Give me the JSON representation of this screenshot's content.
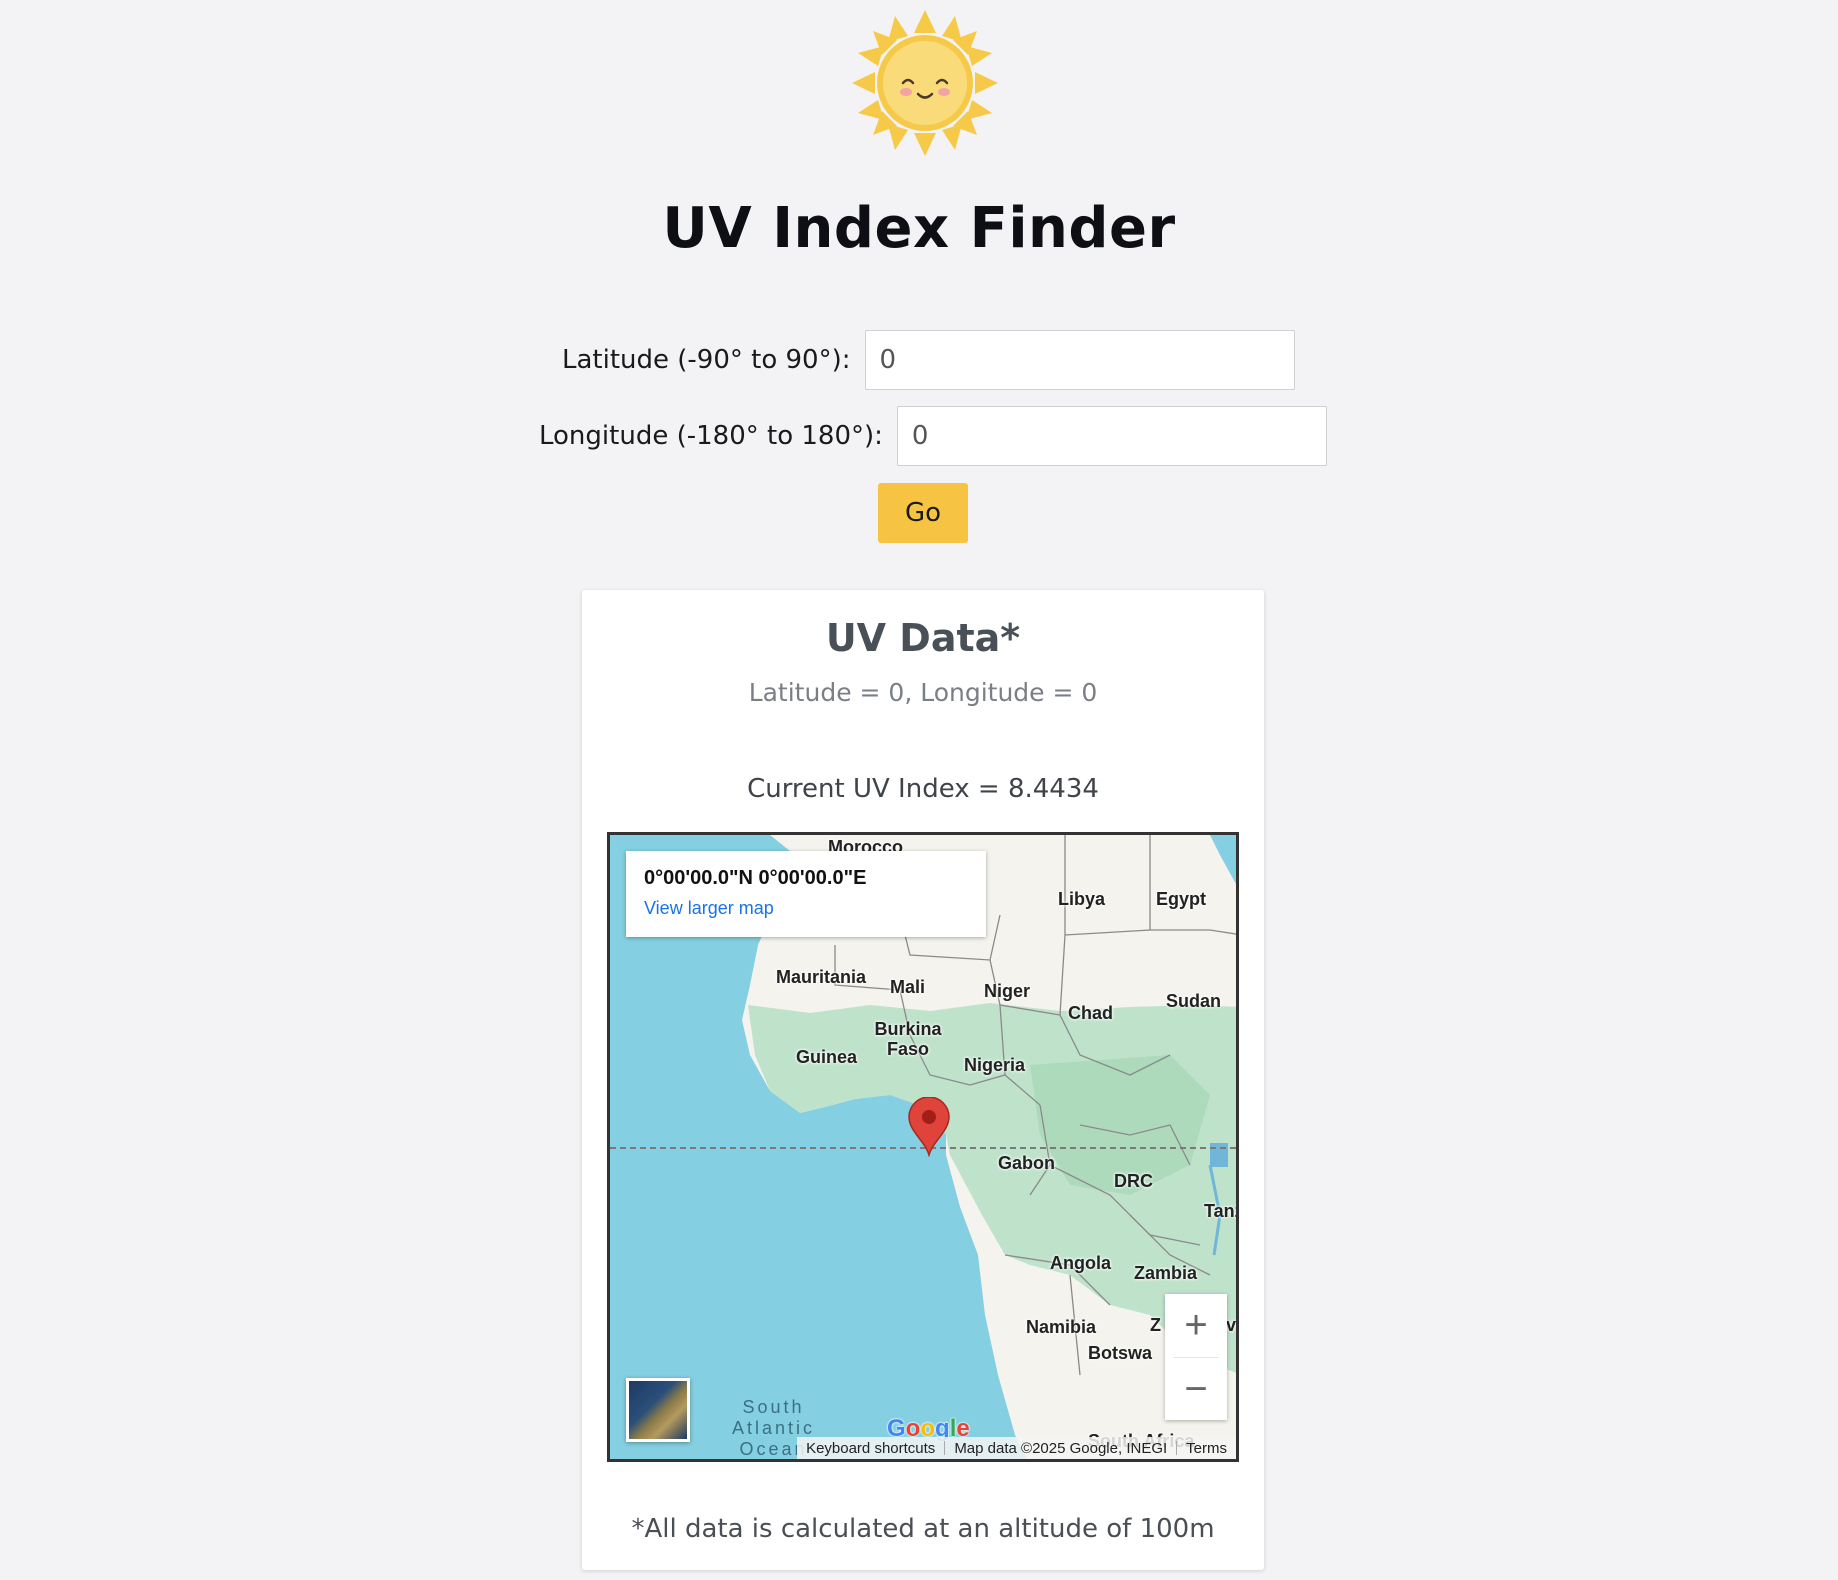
{
  "header": {
    "title": "UV Index Finder",
    "logo_icon": "smiling-sun-icon"
  },
  "form": {
    "latitude_label": "Latitude (-90° to 90°):",
    "latitude_value": "0",
    "longitude_label": "Longitude (-180° to 180°):",
    "longitude_value": "0",
    "go_label": "Go"
  },
  "card": {
    "title": "UV Data*",
    "coords": "Latitude = 0, Longitude = 0",
    "uv_index": "Current UV Index = 8.4434",
    "footnote": "*All data is calculated at an altitude of 100m"
  },
  "map": {
    "info_coords": "0°00'00.0\"N 0°00'00.0\"E",
    "view_larger": "View larger map",
    "zoom_in": "+",
    "zoom_out": "−",
    "ocean_label": "South\nAtlantic\nOcean",
    "logo": "Google",
    "attribution": {
      "shortcuts": "Keyboard shortcuts",
      "data": "Map data ©2025 Google, INEGI",
      "terms": "Terms"
    },
    "places": [
      "Morocco",
      "Libya",
      "Egypt",
      "Mauritania",
      "Mali",
      "Niger",
      "Chad",
      "Sudan",
      "Burkina Faso",
      "Guinea",
      "Nigeria",
      "Gabon",
      "DRC",
      "Tanz",
      "Angola",
      "Zambia",
      "Namibia",
      "Botswa",
      "South Africa",
      "Z",
      "ve"
    ]
  },
  "colors": {
    "accent": "#f6c343",
    "ocean": "#84cfe1",
    "land": "#f4f3ee",
    "forest": "#b9e0c6",
    "pin": "#e0433a"
  }
}
